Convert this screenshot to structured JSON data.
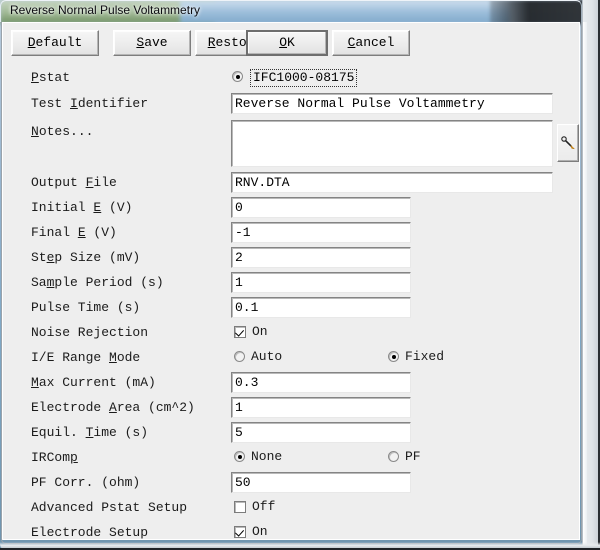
{
  "window": {
    "title": "Reverse Normal Pulse Voltammetry"
  },
  "toolbar": {
    "buttons": [
      {
        "label": "Default",
        "accel": "D",
        "default": false
      },
      {
        "label": "Save",
        "accel": "S",
        "default": false
      },
      {
        "label": "Restore",
        "accel": "R",
        "default": false
      },
      {
        "label": "OK",
        "accel": "O",
        "default": true
      },
      {
        "label": "Cancel",
        "accel": "C",
        "default": false
      }
    ]
  },
  "form": {
    "pstat": {
      "label": "Pstat",
      "accel": "P",
      "value": "IFC1000-08175",
      "selected": true
    },
    "test_identifier": {
      "label": "Test Identifier",
      "accel": "I",
      "value": "Reverse Normal Pulse Voltammetry"
    },
    "notes": {
      "label": "Notes...",
      "accel": "N",
      "value": "",
      "button_icon": "pen-icon"
    },
    "output_file": {
      "label": "Output File",
      "accel": "F",
      "value": "RNV.DTA"
    },
    "initial_e": {
      "label": "Initial E (V)",
      "accel": "E",
      "value": "0"
    },
    "final_e": {
      "label": "Final E (V)",
      "accel": "E",
      "value": "-1"
    },
    "step_size": {
      "label": "Step Size (mV)",
      "accel": "e",
      "value": "2"
    },
    "sample_period": {
      "label": "Sample Period (s)",
      "accel": "m",
      "value": "1"
    },
    "pulse_time": {
      "label": "Pulse Time (s)",
      "value": "0.1"
    },
    "noise_rejection": {
      "label": "Noise Rejection",
      "option_label": "On",
      "checked": true
    },
    "ie_range_mode": {
      "label": "I/E Range Mode",
      "accel": "M",
      "options": [
        {
          "label": "Auto",
          "selected": false
        },
        {
          "label": "Fixed",
          "selected": true
        }
      ]
    },
    "max_current": {
      "label": "Max Current (mA)",
      "accel": "M",
      "value": "0.3"
    },
    "electrode_area": {
      "label": "Electrode Area (cm^2)",
      "accel": "A",
      "value": "1"
    },
    "equil_time": {
      "label": "Equil. Time (s)",
      "accel": "T",
      "value": "5"
    },
    "ircomp": {
      "label": "IRComp",
      "accel": "p",
      "options": [
        {
          "label": "None",
          "selected": true
        },
        {
          "label": "PF",
          "selected": false
        }
      ]
    },
    "pf_corr": {
      "label": "PF Corr. (ohm)",
      "value": "50"
    },
    "advanced_pstat_setup": {
      "label": "Advanced Pstat Setup",
      "option_label": "Off",
      "checked": false
    },
    "electrode_setup": {
      "label": "Electrode Setup",
      "option_label": "On",
      "checked": true
    }
  }
}
